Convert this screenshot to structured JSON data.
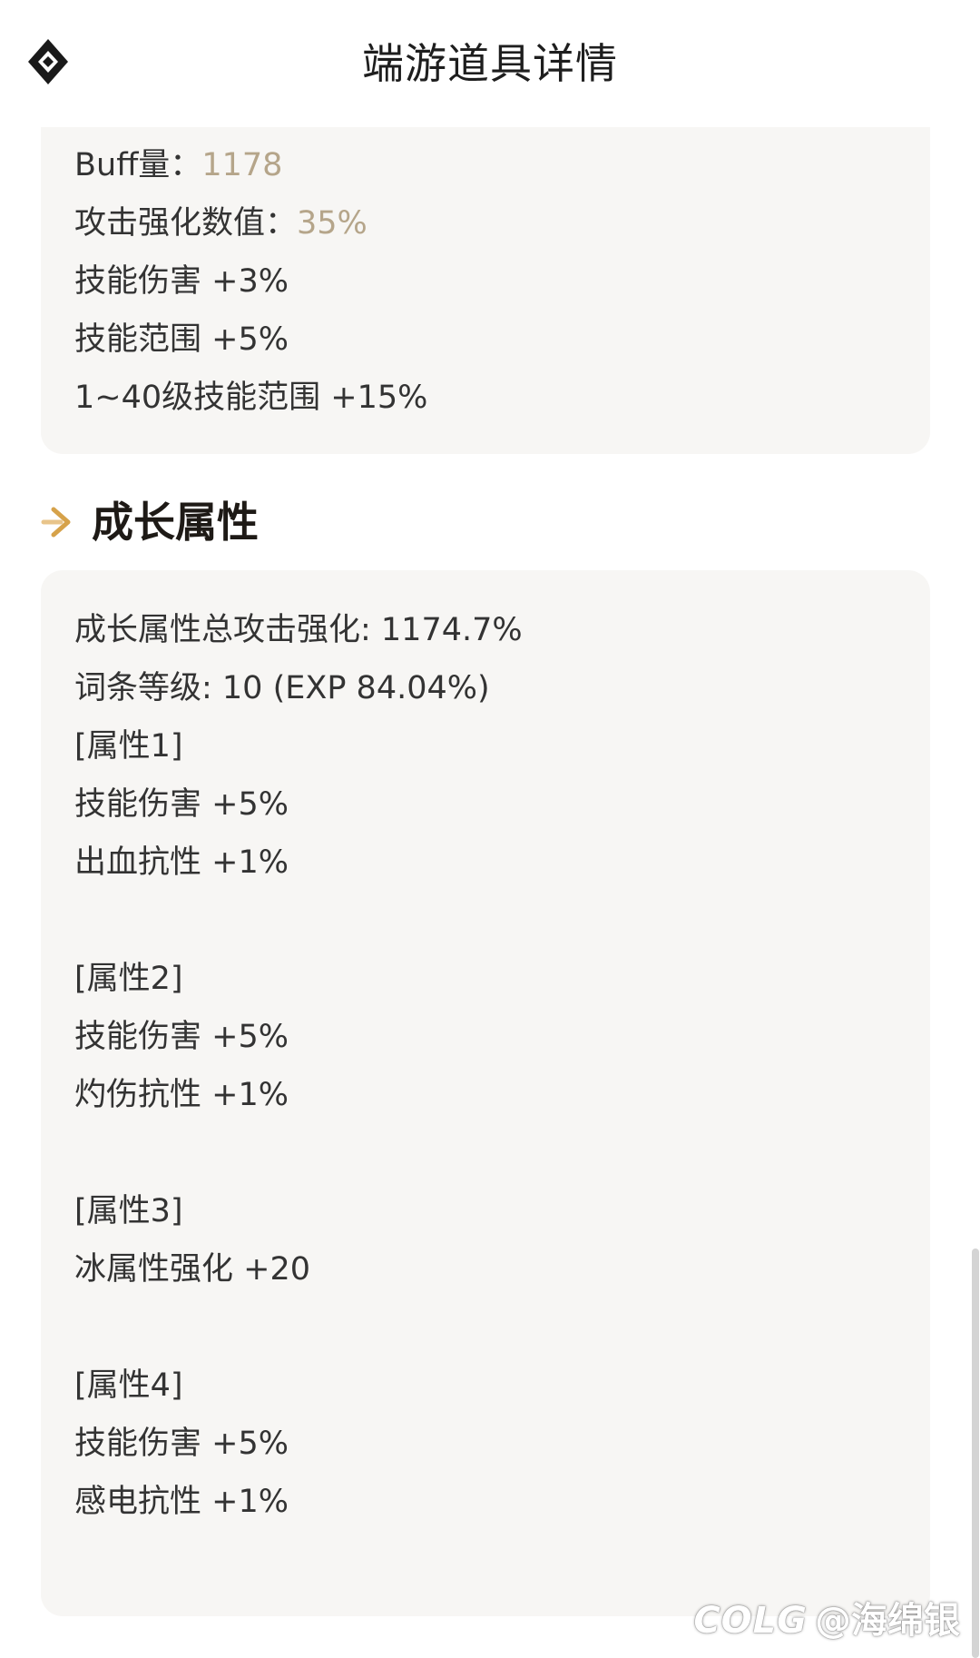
{
  "header": {
    "title": "端游道具详情",
    "logo_icon": "diamond-logo-icon"
  },
  "top_card": {
    "lines": [
      {
        "label": "Buff量：",
        "value": "1178"
      },
      {
        "label": "攻击强化数值：",
        "value": "35%"
      },
      {
        "text": "技能伤害 +3%"
      },
      {
        "text": "技能范围 +5%"
      },
      {
        "text": "1~40级技能范围 +15%"
      }
    ]
  },
  "growth_section": {
    "icon": "arrow-right-icon",
    "title": "成长属性",
    "lines": [
      "成长属性总攻击强化: 1174.7%",
      "词条等级: 10 (EXP 84.04%)",
      "[属性1]",
      "技能伤害 +5%",
      "出血抗性 +1%",
      "[属性2]",
      "技能伤害 +5%",
      "灼伤抗性 +1%",
      "[属性3]",
      "冰属性强化 +20",
      "[属性4]",
      "技能伤害 +5%",
      "感电抗性 +1%"
    ]
  },
  "watermark": {
    "logo": "COLG",
    "user": "@海绵银"
  },
  "colors": {
    "accent_gold": "#b5a58a",
    "arrow_gold": "#d6a24a",
    "card_bg": "#f7f6f4"
  }
}
